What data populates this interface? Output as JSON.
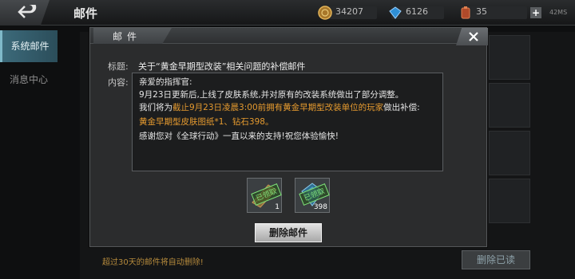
{
  "topbar": {
    "title": "邮件",
    "gold": "34207",
    "gems": "6126",
    "stamina": "35",
    "ping": "42MS"
  },
  "sidebar": {
    "items": [
      {
        "label": "系统邮件",
        "active": true
      },
      {
        "label": "消息中心",
        "active": false
      }
    ]
  },
  "background": {
    "footer_note": "超过30天的邮件将自动删除!",
    "delete_read_label": "删除已读"
  },
  "modal": {
    "title": "邮件",
    "subject_label": "标题:",
    "subject": "关于“黄金早期型改装”相关问题的补偿邮件",
    "content_label": "内容:",
    "lines": {
      "l1": "亲爱的指挥官:",
      "l2": "9月23日更新后,上线了皮肤系统,并对原有的改装系统做出了部分调整。",
      "l3a": "我们将为",
      "l3b": "截止9月23日凌晨3:00前拥有黄金早期型改装单位的玩家",
      "l3c": "做出补偿:",
      "l4": "黄金早期型皮肤图纸*1、钻石398。",
      "l5": "感谢您对《全球行动》一直以来的支持!祝您体验愉快!"
    },
    "attachments": [
      {
        "icon": "blueprint-icon",
        "stamp": "已领取",
        "qty": "1"
      },
      {
        "icon": "diamond-icon",
        "stamp": "已领取",
        "qty": "398"
      }
    ],
    "delete_label": "删除邮件"
  },
  "colors": {
    "accent_orange": "#e59a2f",
    "claimed_green": "#7fe07a",
    "sidebar_active": "#3c6a7a"
  }
}
